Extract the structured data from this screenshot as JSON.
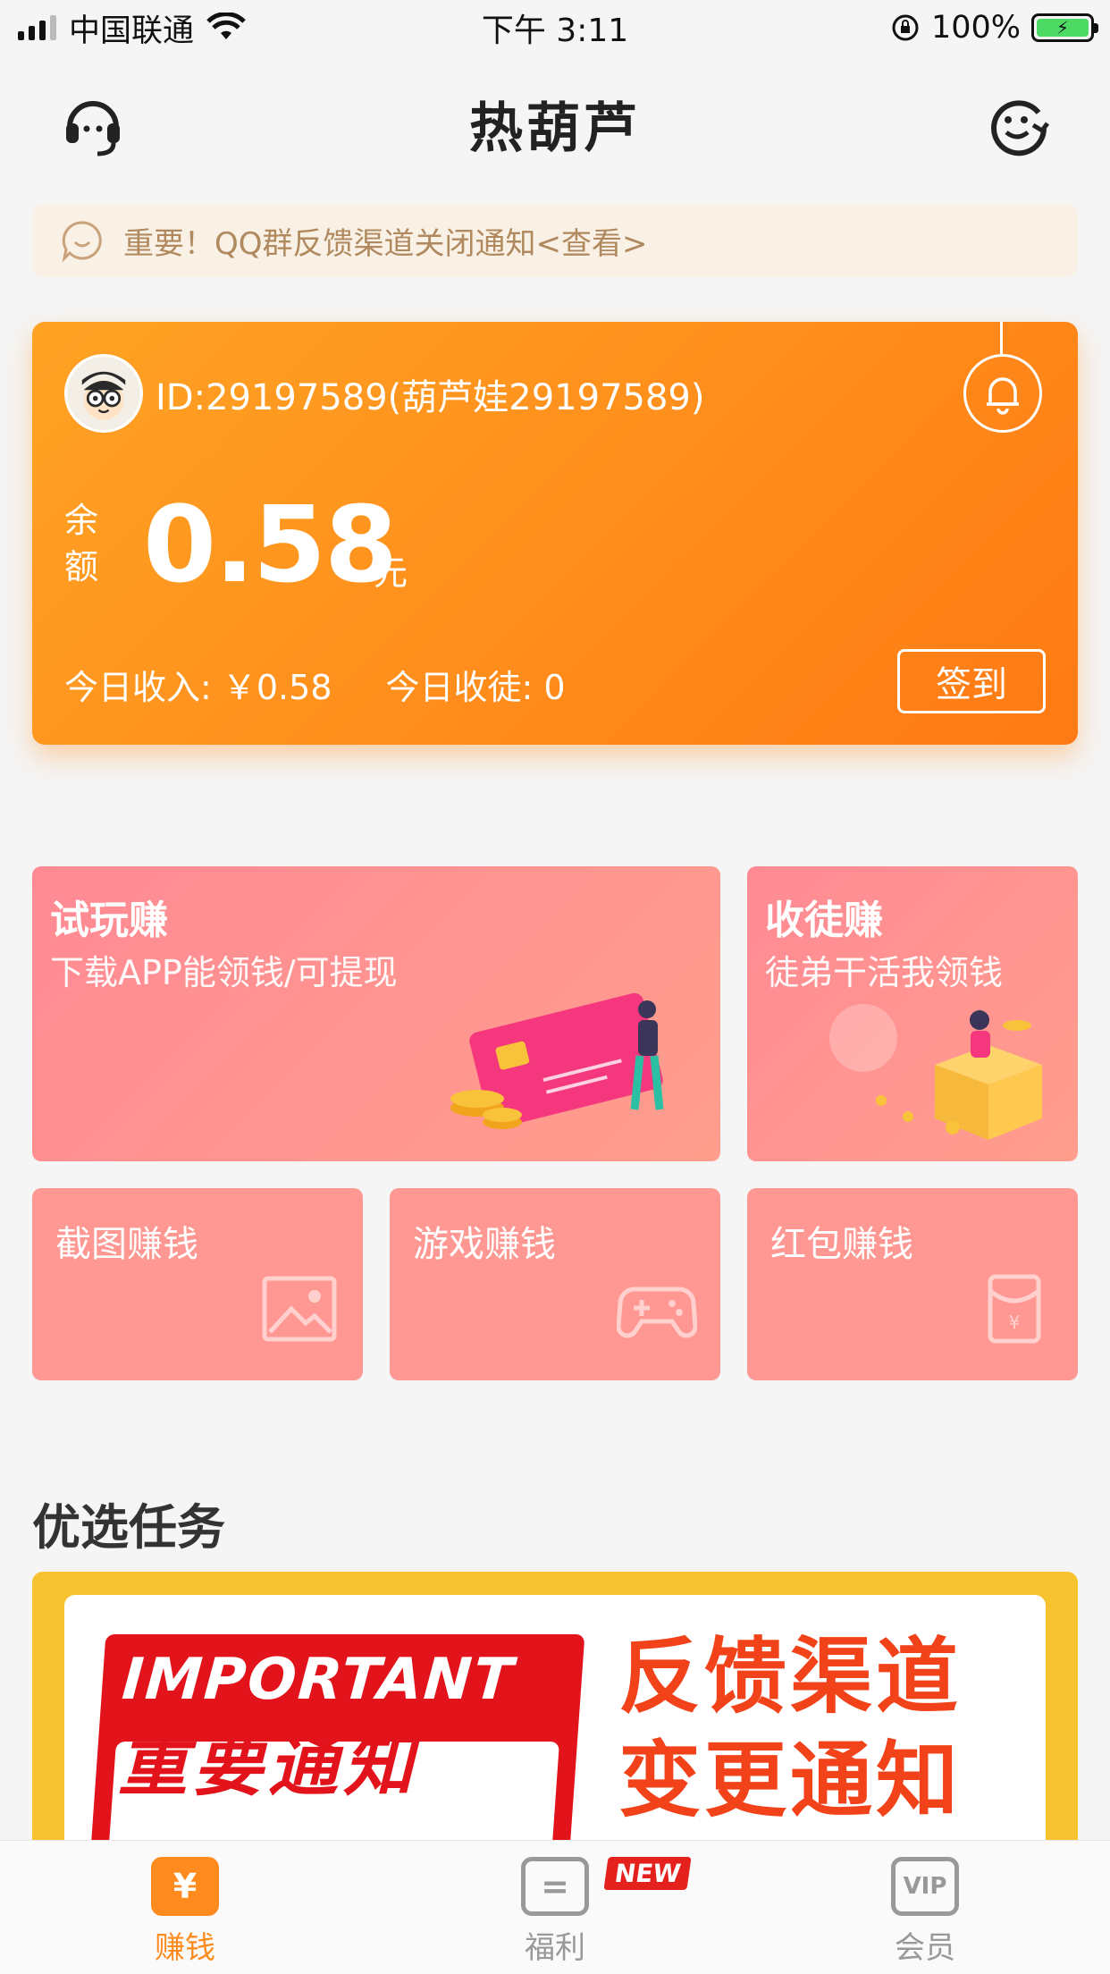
{
  "status_bar": {
    "carrier": "中国联通",
    "time": "下午 3:11",
    "battery": "100%"
  },
  "header": {
    "title": "热葫芦",
    "support_icon": "headset-icon",
    "profile_icon": "smiley-face-icon"
  },
  "notice": {
    "text": "重要！QQ群反馈渠道关闭通知<查看>",
    "icon": "chat-smile-icon"
  },
  "balance_card": {
    "user_id": "ID:29197589(葫芦娃29197589)",
    "balance_label": "余额",
    "balance_value": "0.58",
    "balance_unit": "元",
    "today_income": "今日收入: ￥0.58",
    "today_disciples": "今日收徒: 0",
    "checkin_label": "签到",
    "colors": {
      "start": "#ffa324",
      "end": "#ff7a14"
    }
  },
  "features": {
    "trial": {
      "title": "试玩赚",
      "subtitle": "下载APP能领钱/可提现"
    },
    "recruit": {
      "title": "收徒赚",
      "subtitle": "徒弟干活我领钱"
    },
    "screenshot": {
      "title": "截图赚钱",
      "icon": "image-icon"
    },
    "game": {
      "title": "游戏赚钱",
      "icon": "gamepad-icon"
    },
    "redpacket": {
      "title": "红包赚钱",
      "icon": "red-envelope-icon"
    }
  },
  "section": {
    "title": "优选任务"
  },
  "banner": {
    "en": "IMPORTANT",
    "cn_left": "重要通知",
    "line1": "反馈渠道",
    "line2": "变更通知"
  },
  "tabbar": {
    "tabs": [
      {
        "label": "赚钱",
        "icon": "yen-ticket-icon",
        "active": true
      },
      {
        "label": "福利",
        "icon": "ticket-icon",
        "active": false,
        "badge": "NEW"
      },
      {
        "label": "会员",
        "icon": "vip-icon",
        "active": false
      }
    ]
  }
}
